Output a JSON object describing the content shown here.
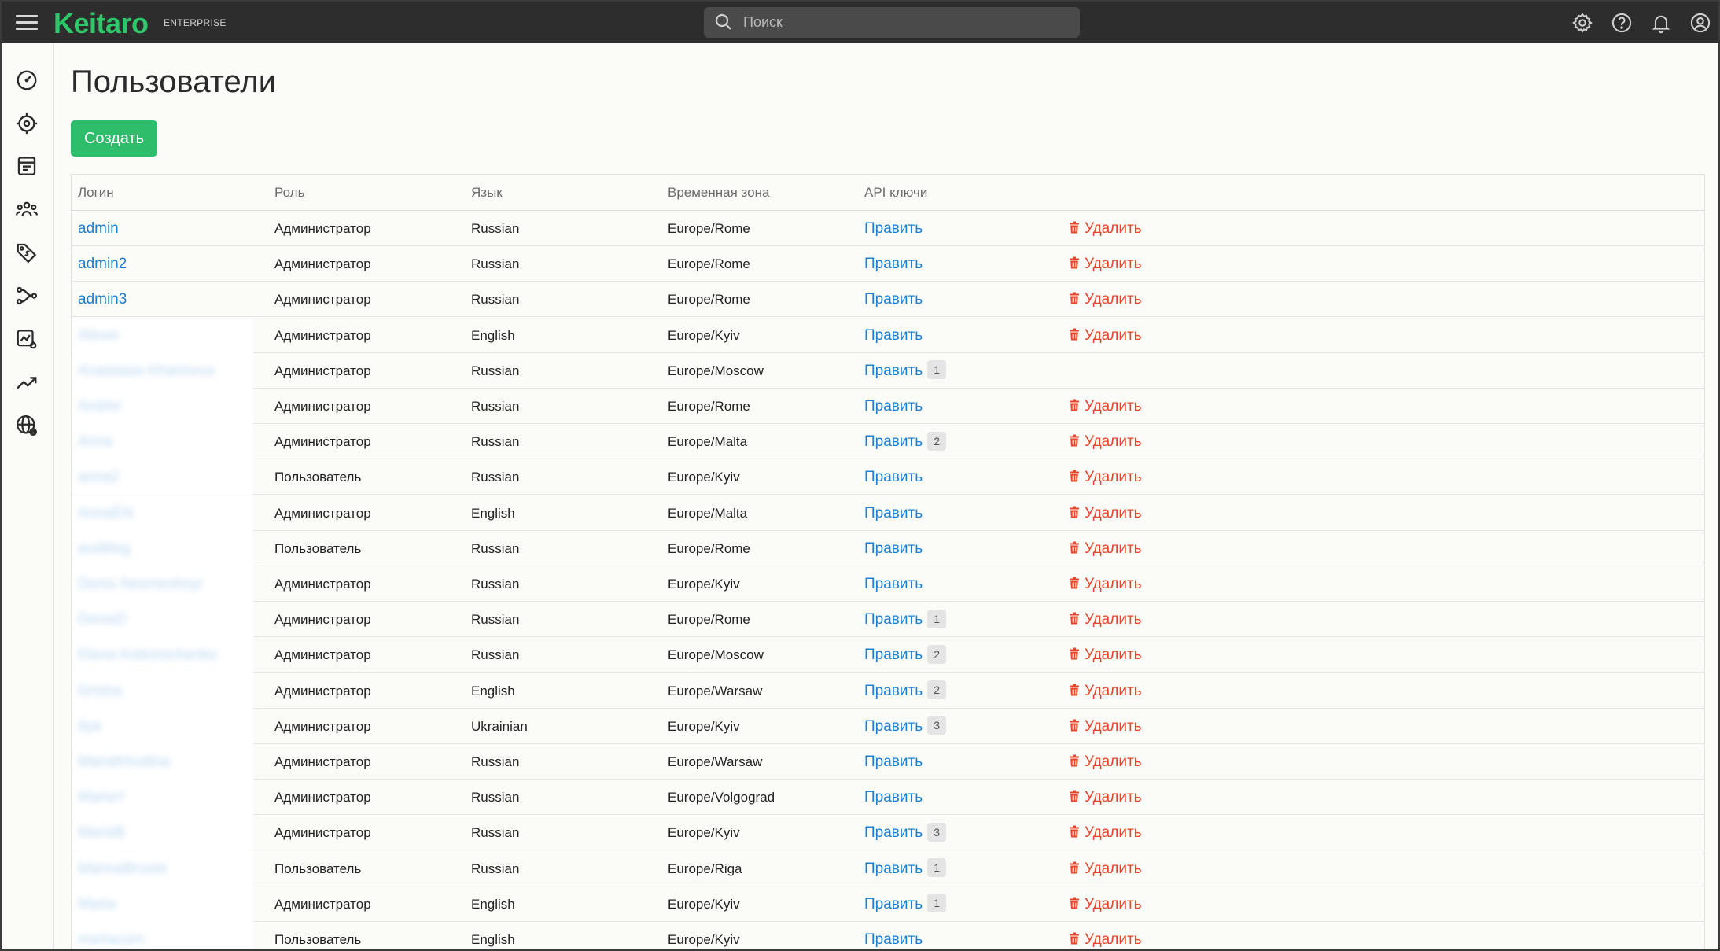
{
  "app": {
    "logo": "Keitaro",
    "edition": "ENTERPRISE"
  },
  "search": {
    "placeholder": "Поиск"
  },
  "topbar_icons": [
    "gear-icon",
    "help-icon",
    "bell-icon",
    "user-icon"
  ],
  "sidebar_icons": [
    "dashboard-icon",
    "target-icon",
    "campaigns-icon",
    "users-group-icon",
    "offers-icon",
    "flows-icon",
    "reports-icon",
    "trends-icon",
    "globe-settings-icon"
  ],
  "page": {
    "title": "Пользователи",
    "create_label": "Создать"
  },
  "table": {
    "headers": {
      "login": "Логин",
      "role": "Роль",
      "language": "Язык",
      "timezone": "Временная зона",
      "api_keys": "API ключи"
    },
    "edit_label": "Править",
    "delete_label": "Удалить",
    "rows": [
      {
        "login": "admin",
        "blurred": false,
        "role": "Администратор",
        "language": "Russian",
        "timezone": "Europe/Rome",
        "api_count": "",
        "deletable": true
      },
      {
        "login": "admin2",
        "blurred": false,
        "role": "Администратор",
        "language": "Russian",
        "timezone": "Europe/Rome",
        "api_count": "",
        "deletable": true
      },
      {
        "login": "admin3",
        "blurred": false,
        "role": "Администратор",
        "language": "Russian",
        "timezone": "Europe/Rome",
        "api_count": "",
        "deletable": true
      },
      {
        "login": "Alexei",
        "blurred": true,
        "role": "Администратор",
        "language": "English",
        "timezone": "Europe/Kyiv",
        "api_count": "",
        "deletable": true
      },
      {
        "login": "Anastasia Kharinova",
        "blurred": true,
        "role": "Администратор",
        "language": "Russian",
        "timezone": "Europe/Moscow",
        "api_count": "1",
        "deletable": false
      },
      {
        "login": "Andrei",
        "blurred": true,
        "role": "Администратор",
        "language": "Russian",
        "timezone": "Europe/Rome",
        "api_count": "",
        "deletable": true
      },
      {
        "login": "Anna",
        "blurred": true,
        "role": "Администратор",
        "language": "Russian",
        "timezone": "Europe/Malta",
        "api_count": "2",
        "deletable": true
      },
      {
        "login": "anna2",
        "blurred": true,
        "role": "Пользователь",
        "language": "Russian",
        "timezone": "Europe/Kyiv",
        "api_count": "",
        "deletable": true
      },
      {
        "login": "AnnaEN",
        "blurred": true,
        "role": "Администратор",
        "language": "English",
        "timezone": "Europe/Malta",
        "api_count": "",
        "deletable": true
      },
      {
        "login": "auditlog",
        "blurred": true,
        "role": "Пользователь",
        "language": "Russian",
        "timezone": "Europe/Rome",
        "api_count": "",
        "deletable": true
      },
      {
        "login": "Denis Nesmeshnyi",
        "blurred": true,
        "role": "Администратор",
        "language": "Russian",
        "timezone": "Europe/Kyiv",
        "api_count": "",
        "deletable": true
      },
      {
        "login": "DenisD",
        "blurred": true,
        "role": "Администратор",
        "language": "Russian",
        "timezone": "Europe/Rome",
        "api_count": "1",
        "deletable": true
      },
      {
        "login": "Elena Kolesnichenko",
        "blurred": true,
        "role": "Администратор",
        "language": "Russian",
        "timezone": "Europe/Moscow",
        "api_count": "2",
        "deletable": true
      },
      {
        "login": "Grisha",
        "blurred": true,
        "role": "Администратор",
        "language": "English",
        "timezone": "Europe/Warsaw",
        "api_count": "2",
        "deletable": true
      },
      {
        "login": "Ilya",
        "blurred": true,
        "role": "Администратор",
        "language": "Ukrainian",
        "timezone": "Europe/Kyiv",
        "api_count": "3",
        "deletable": true
      },
      {
        "login": "MariaKhodina",
        "blurred": true,
        "role": "Администратор",
        "language": "Russian",
        "timezone": "Europe/Warsaw",
        "api_count": "",
        "deletable": true
      },
      {
        "login": "MariaY",
        "blurred": true,
        "role": "Администратор",
        "language": "Russian",
        "timezone": "Europe/Volgograd",
        "api_count": "",
        "deletable": true
      },
      {
        "login": "MariaB",
        "blurred": true,
        "role": "Администратор",
        "language": "Russian",
        "timezone": "Europe/Kyiv",
        "api_count": "3",
        "deletable": true
      },
      {
        "login": "MarinaBruset",
        "blurred": true,
        "role": "Пользователь",
        "language": "Russian",
        "timezone": "Europe/Riga",
        "api_count": "1",
        "deletable": true
      },
      {
        "login": "Marta",
        "blurred": true,
        "role": "Администратор",
        "language": "English",
        "timezone": "Europe/Kyiv",
        "api_count": "1",
        "deletable": true
      },
      {
        "login": "martacom",
        "blurred": true,
        "role": "Пользователь",
        "language": "English",
        "timezone": "Europe/Kyiv",
        "api_count": "",
        "deletable": true
      }
    ]
  },
  "colors": {
    "brand": "#2fc76a",
    "link": "#1a7fd6",
    "danger": "#e7442b",
    "topbar": "#2d2d2d"
  }
}
